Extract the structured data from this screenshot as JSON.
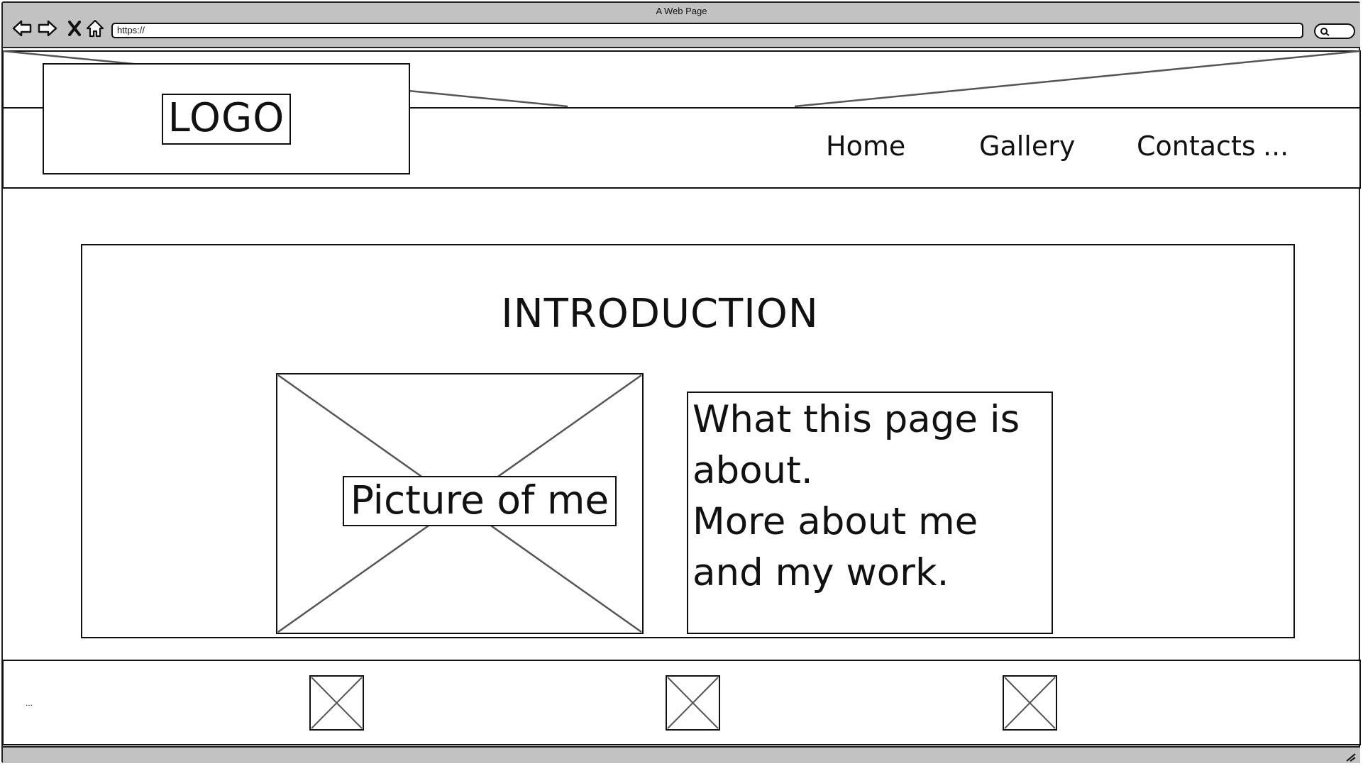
{
  "browser": {
    "window_title": "A Web Page",
    "url": "https://",
    "icons": [
      "back-arrow-icon",
      "forward-arrow-icon",
      "stop-icon",
      "home-icon",
      "search-icon",
      "resize-grip-icon"
    ]
  },
  "header": {
    "logo_text": "LOGO",
    "nav_items": [
      {
        "label": "Home"
      },
      {
        "label": "Gallery"
      },
      {
        "label": "Contacts"
      }
    ],
    "nav_more": "..."
  },
  "main": {
    "section_title": "INTRODUCTION",
    "picture_label": "Picture of me",
    "about_lines": [
      "What this page is",
      "about.",
      "More about me",
      "and my work."
    ]
  },
  "footer": {
    "left_text": "...",
    "icons": [
      "image-placeholder-icon",
      "image-placeholder-icon",
      "image-placeholder-icon"
    ]
  },
  "colors": {
    "chrome_gray": "#c2c2c2",
    "line_black": "#111111",
    "placeholder_line": "#555555"
  }
}
